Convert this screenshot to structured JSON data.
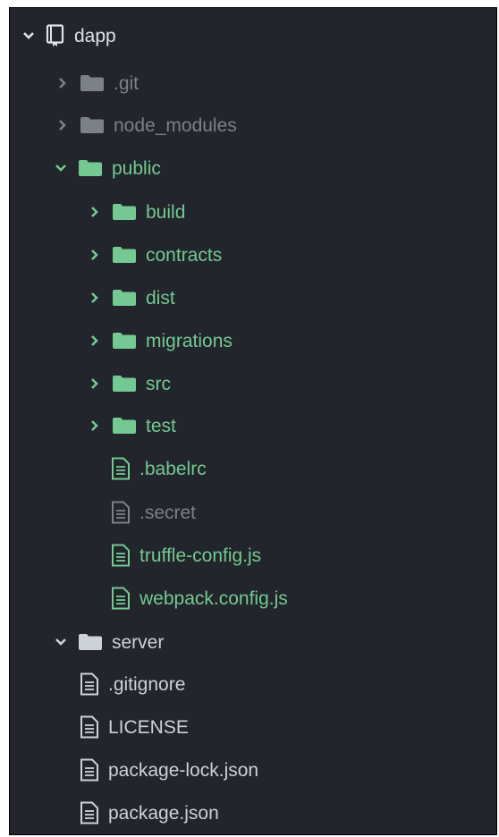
{
  "colors": {
    "panel_bg": "#22252b",
    "root_text": "#dfe2e8",
    "ignored": "#7c8188",
    "modified_green": "#73c991",
    "plain_text": "#cdd1d8"
  },
  "tree": {
    "root": {
      "label": "dapp",
      "icon": "repo-icon",
      "expanded": true
    },
    "items": [
      {
        "label": ".git",
        "type": "folder",
        "expanded": false,
        "status": "ignored"
      },
      {
        "label": "node_modules",
        "type": "folder",
        "expanded": false,
        "status": "ignored"
      },
      {
        "label": "public",
        "type": "folder",
        "expanded": true,
        "status": "green"
      },
      {
        "label": "build",
        "type": "folder",
        "expanded": false,
        "status": "green"
      },
      {
        "label": "contracts",
        "type": "folder",
        "expanded": false,
        "status": "green"
      },
      {
        "label": "dist",
        "type": "folder",
        "expanded": false,
        "status": "green"
      },
      {
        "label": "migrations",
        "type": "folder",
        "expanded": false,
        "status": "green"
      },
      {
        "label": "src",
        "type": "folder",
        "expanded": false,
        "status": "green"
      },
      {
        "label": "test",
        "type": "folder",
        "expanded": false,
        "status": "green"
      },
      {
        "label": ".babelrc",
        "type": "file",
        "status": "green"
      },
      {
        "label": ".secret",
        "type": "file",
        "status": "ignored"
      },
      {
        "label": "truffle-config.js",
        "type": "file",
        "status": "green"
      },
      {
        "label": "webpack.config.js",
        "type": "file",
        "status": "green"
      },
      {
        "label": "server",
        "type": "folder",
        "expanded": true,
        "status": "plain"
      },
      {
        "label": ".gitignore",
        "type": "file",
        "status": "plain"
      },
      {
        "label": "LICENSE",
        "type": "file",
        "status": "plain"
      },
      {
        "label": "package-lock.json",
        "type": "file",
        "status": "plain"
      },
      {
        "label": "package.json",
        "type": "file",
        "status": "plain"
      }
    ]
  }
}
